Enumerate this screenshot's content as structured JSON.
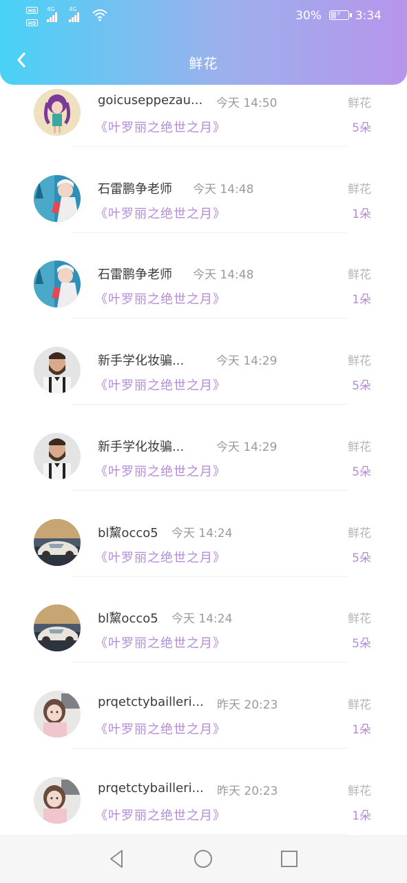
{
  "status_bar": {
    "network_1": "4G",
    "network_2": "4G",
    "battery_percent": "30%",
    "battery_level": 0.3,
    "time": "3:34"
  },
  "header": {
    "title": "鲜花",
    "back_icon": "chevron-left-icon",
    "gradient_start": "#48d2f6",
    "gradient_end": "#b795eb"
  },
  "records": [
    {
      "name": "goicuseppezau...",
      "time": "今天 14:50",
      "gift_type": "鲜花",
      "target": "《叶罗丽之绝世之月》",
      "count": "5朵",
      "avatar": "cartoon-girl"
    },
    {
      "name": "石雷鹏争老师",
      "time": "今天 14:48",
      "gift_type": "鲜花",
      "target": "《叶罗丽之绝世之月》",
      "count": "1朵",
      "avatar": "girl-winter"
    },
    {
      "name": "石雷鹏争老师",
      "time": "今天 14:48",
      "gift_type": "鲜花",
      "target": "《叶罗丽之绝世之月》",
      "count": "1朵",
      "avatar": "girl-winter"
    },
    {
      "name": "新手学化妆骗...",
      "time": "今天 14:29",
      "gift_type": "鲜花",
      "target": "《叶罗丽之绝世之月》",
      "count": "5朵",
      "avatar": "bearded-man"
    },
    {
      "name": "新手学化妆骗...",
      "time": "今天 14:29",
      "gift_type": "鲜花",
      "target": "《叶罗丽之绝世之月》",
      "count": "5朵",
      "avatar": "bearded-man"
    },
    {
      "name": "bl黧occo5",
      "time": "今天 14:24",
      "gift_type": "鲜花",
      "target": "《叶罗丽之绝世之月》",
      "count": "5朵",
      "avatar": "white-car"
    },
    {
      "name": "bl黧occo5",
      "time": "今天 14:24",
      "gift_type": "鲜花",
      "target": "《叶罗丽之绝世之月》",
      "count": "5朵",
      "avatar": "white-car"
    },
    {
      "name": "prqetctybailleri...",
      "time": "昨天 20:23",
      "gift_type": "鲜花",
      "target": "《叶罗丽之绝世之月》",
      "count": "1朵",
      "avatar": "little-girl"
    },
    {
      "name": "prqetctybailleri...",
      "time": "昨天 20:23",
      "gift_type": "鲜花",
      "target": "《叶罗丽之绝世之月》",
      "count": "1朵",
      "avatar": "little-girl"
    }
  ],
  "nav_bar": {
    "back": "triangle-back-icon",
    "home": "circle-home-icon",
    "recents": "square-recents-icon"
  }
}
